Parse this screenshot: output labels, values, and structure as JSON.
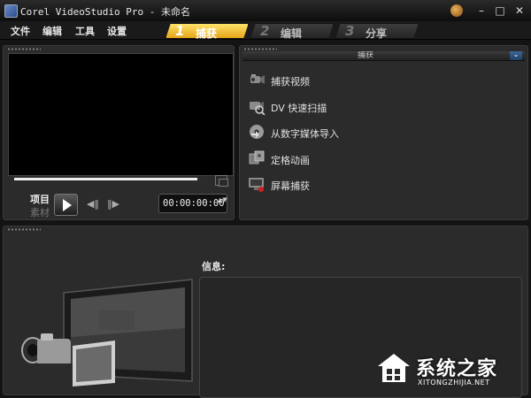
{
  "window": {
    "title": "Corel VideoStudio Pro - 未命名",
    "controls": {
      "minimize": "–",
      "maximize": "□",
      "close": "✕"
    }
  },
  "menu": {
    "items": [
      {
        "label": "文件"
      },
      {
        "label": "编辑"
      },
      {
        "label": "工具"
      },
      {
        "label": "设置"
      }
    ]
  },
  "steps": [
    {
      "number": "1",
      "label": "捕获",
      "active": true
    },
    {
      "number": "2",
      "label": "编辑",
      "active": false
    },
    {
      "number": "3",
      "label": "分享",
      "active": false
    }
  ],
  "preview": {
    "mode_project": "项目",
    "mode_clip": "素材",
    "timecode": "00:00:00:00",
    "prev_frame": "◀‖",
    "next_frame": "‖▶",
    "spinner": "▲▼"
  },
  "capture": {
    "header_label": "捕获",
    "collapse_icon": "⌄",
    "items": [
      {
        "label": "捕获视频",
        "icon": "video-camera-icon"
      },
      {
        "label": "DV 快速扫描",
        "icon": "dv-scan-icon"
      },
      {
        "label": "从数字媒体导入",
        "icon": "disc-import-icon"
      },
      {
        "label": "定格动画",
        "icon": "stop-motion-icon"
      },
      {
        "label": "屏幕捕获",
        "icon": "screen-capture-icon"
      }
    ]
  },
  "info": {
    "label": "信息:"
  },
  "watermark": {
    "title": "系统之家",
    "url": "XITONGZHIJIA.NET"
  },
  "colors": {
    "active_tab": "#f2c53a",
    "background": "#141414",
    "panel": "#2b2b2b"
  }
}
